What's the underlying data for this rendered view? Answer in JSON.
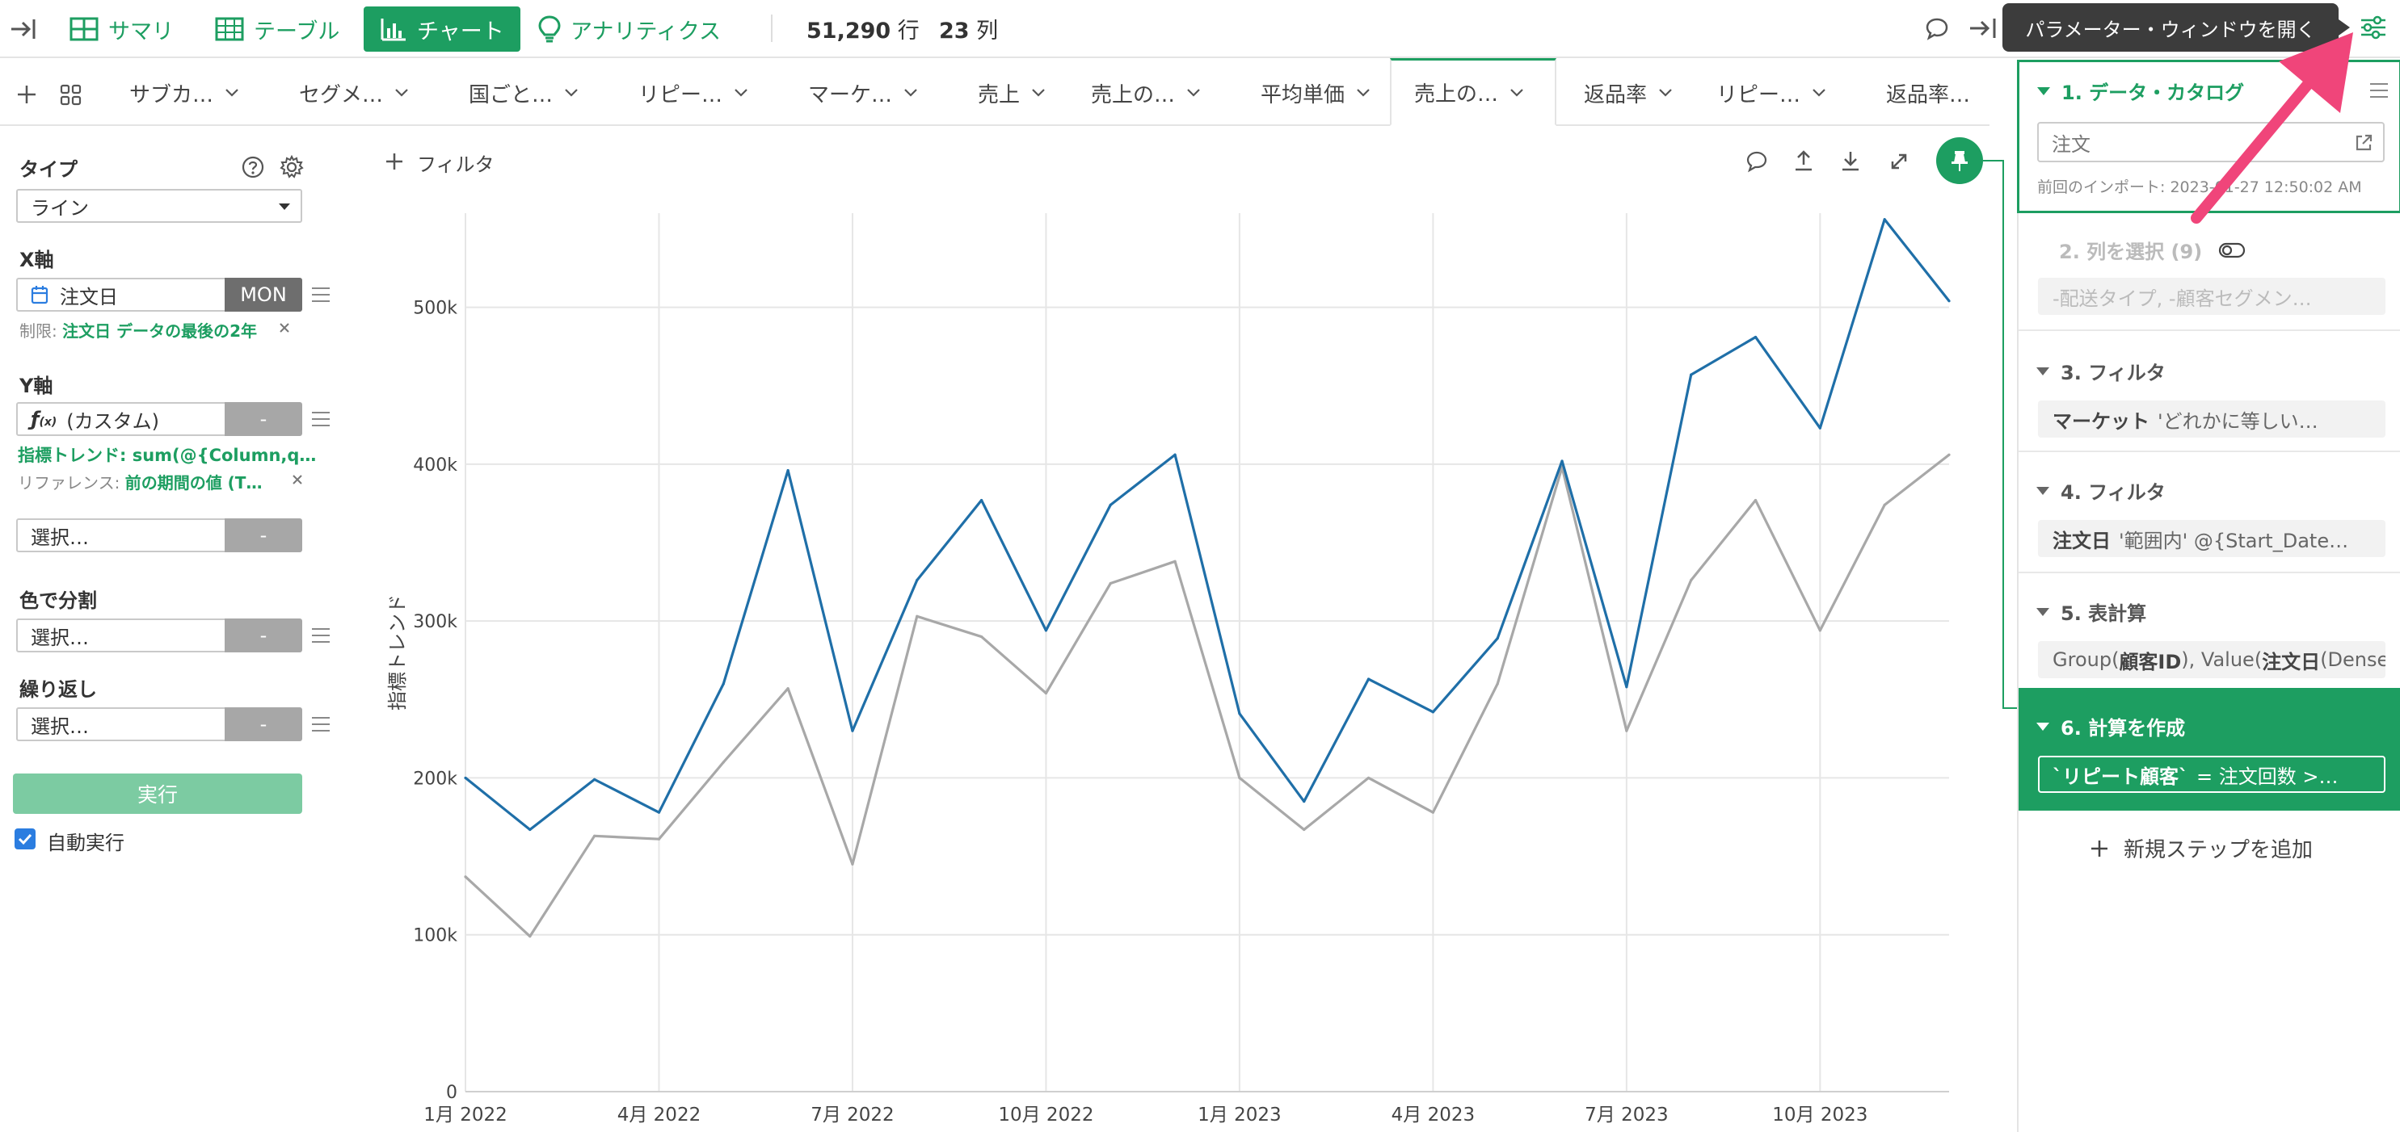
{
  "toolbar": {
    "summary": "サマリ",
    "table": "テーブル",
    "chart": "チャート",
    "analytics": "アナリティクス",
    "rows_value": "51,290",
    "rows_unit": "行",
    "cols_value": "23",
    "cols_unit": "列",
    "tooltip": "パラメーター・ウィンドウを開く"
  },
  "tabs": [
    {
      "label": "サブカ…"
    },
    {
      "label": "セグメ…"
    },
    {
      "label": "国ごと…"
    },
    {
      "label": "リピー…"
    },
    {
      "label": "マーケ…"
    },
    {
      "label": "売上"
    },
    {
      "label": "売上の…"
    },
    {
      "label": "平均単価"
    },
    {
      "label": "売上の…"
    },
    {
      "label": "返品率"
    },
    {
      "label": "リピー…"
    },
    {
      "label": "返品率…"
    }
  ],
  "left": {
    "type_label": "タイプ",
    "type_value": "ライン",
    "x_label": "X軸",
    "x_field": "注文日",
    "x_unit": "MON",
    "x_limit_prefix": "制限:",
    "x_limit": "注文日 データの最後の2年",
    "y_label": "Y軸",
    "y_field": "(カスタム)",
    "y_dash": "-",
    "y_expr": "指標トレンド: sum(@{Column,q…",
    "ref_prefix": "リファレンス:",
    "ref_value": "前の期間の値 (T…",
    "select_placeholder": "選択…",
    "dash": "-",
    "color_label": "色で分割",
    "repeat_label": "繰り返し",
    "run_label": "実行",
    "auto_run_label": "自動実行"
  },
  "chart_header": {
    "filter_label": "フィルタ"
  },
  "chart_data": {
    "type": "line",
    "ylabel": "指標トレンド",
    "ylim": [
      0,
      560000
    ],
    "yticks": [
      "0",
      "100k",
      "200k",
      "300k",
      "400k",
      "500k"
    ],
    "ytick_values": [
      0,
      100000,
      200000,
      300000,
      400000,
      500000
    ],
    "xticks": [
      "1月 2022",
      "4月 2022",
      "7月 2022",
      "10月 2022",
      "1月 2023",
      "4月 2023",
      "7月 2023",
      "10月 2023"
    ],
    "x": [
      "2022-01",
      "2022-02",
      "2022-03",
      "2022-04",
      "2022-05",
      "2022-06",
      "2022-07",
      "2022-08",
      "2022-09",
      "2022-10",
      "2022-11",
      "2022-12",
      "2023-01",
      "2023-02",
      "2023-03",
      "2023-04",
      "2023-05",
      "2023-06",
      "2023-07",
      "2023-08",
      "2023-09",
      "2023-10",
      "2023-11",
      "2023-12"
    ],
    "series": [
      {
        "color": "#1f6fa8",
        "values": [
          200000,
          167000,
          199000,
          178000,
          260000,
          396000,
          230000,
          326000,
          377000,
          294000,
          374000,
          406000,
          241000,
          185000,
          263000,
          242000,
          289000,
          402000,
          258000,
          457000,
          481000,
          423000,
          556000,
          504000
        ]
      },
      {
        "color": "#a8a8a8",
        "values": [
          137000,
          99000,
          163000,
          161000,
          210000,
          257000,
          145000,
          303000,
          290000,
          254000,
          324000,
          338000,
          200000,
          167000,
          200000,
          178000,
          260000,
          398000,
          230000,
          326000,
          377000,
          294000,
          374000,
          406000
        ]
      }
    ],
    "grid": true
  },
  "right": {
    "step1_title": "1. データ・カタログ",
    "step1_input": "注文",
    "step1_import": "前回のインポート: 2023-01-27 12:50:02 AM",
    "step2_title": "2. 列を選択 (9)",
    "step2_box": "-配送タイプ, -顧客セグメン…",
    "step3_title": "3. フィルタ",
    "step3_key": "マーケット",
    "step3_box": "'どれかに等しい…",
    "step4_title": "4. フィルタ",
    "step4_key": "注文日",
    "step4_box": "'範囲内' @{Start_Date…",
    "step5_title": "5. 表計算",
    "step5_box_a": "Group(",
    "step5_box_b": "顧客ID",
    "step5_box_c": "), Value(",
    "step5_box_d": "注文日",
    "step5_box_e": " (Dense…",
    "step6_title": "6. 計算を作成",
    "step6_key": "`リピート顧客`",
    "step6_box": "= 注文回数 >…",
    "add_step": "新規ステップを追加"
  },
  "colors": {
    "accent": "#1d9e61",
    "series_primary": "#1f6fa8",
    "series_reference": "#a8a8a8",
    "arrow": "#f0457a"
  }
}
